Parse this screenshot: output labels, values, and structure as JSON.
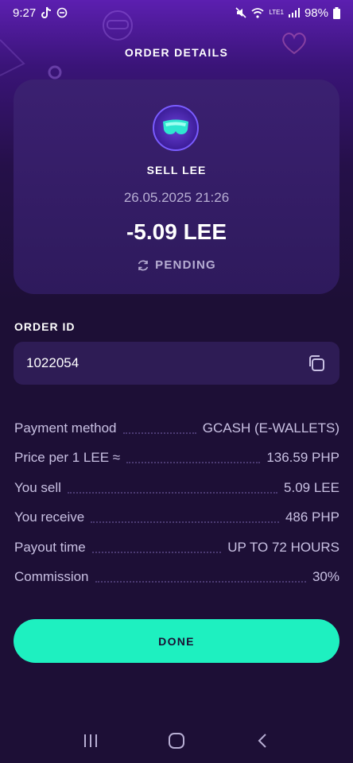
{
  "status_bar": {
    "time": "9:27",
    "battery": "98%",
    "network": "LTE1"
  },
  "header": {
    "title": "ORDER DETAILS"
  },
  "card": {
    "title": "SELL LEE",
    "datetime": "26.05.2025 21:26",
    "amount": "-5.09 LEE",
    "status": "PENDING",
    "avatar_icon": "goggles-icon"
  },
  "order_id": {
    "label": "ORDER ID",
    "value": "1022054"
  },
  "details": [
    {
      "label": "Payment method",
      "value": "GCASH (E-WALLETS)"
    },
    {
      "label": "Price per 1 LEE ≈",
      "value": "136.59 PHP"
    },
    {
      "label": "You sell",
      "value": "5.09 LEE"
    },
    {
      "label": "You receive",
      "value": "486 PHP"
    },
    {
      "label": "Payout time",
      "value": "UP TO 72 HOURS"
    },
    {
      "label": "Commission",
      "value": "30%"
    }
  ],
  "done_button": {
    "label": "DONE"
  },
  "colors": {
    "accent": "#1ef0c0",
    "background": "#1d0f36",
    "card": "#2e1a5c"
  }
}
